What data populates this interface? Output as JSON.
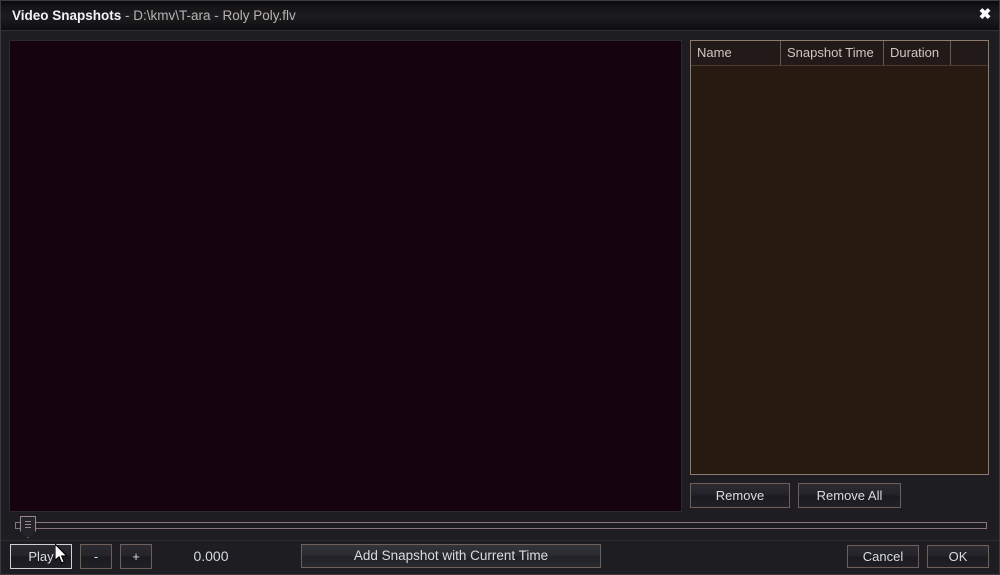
{
  "window": {
    "title_main": "Video Snapshots",
    "title_sub": " - D:\\kmv\\T-ara - Roly Poly.flv",
    "close_label": "✖",
    "bg_color": "#1e1e22"
  },
  "video_preview": {
    "bg_color": "#14020f"
  },
  "snapshot_list": {
    "columns": [
      {
        "label": "Name"
      },
      {
        "label": "Snapshot Time"
      },
      {
        "label": "Duration"
      },
      {
        "label": ""
      }
    ],
    "rows": [],
    "bg_color": "#271a10",
    "border_color": "#8d7b70"
  },
  "list_actions": {
    "remove_label": "Remove",
    "remove_all_label": "Remove All"
  },
  "timeline": {
    "position": 0,
    "min": 0,
    "max": 100
  },
  "transport": {
    "play_label": "Play",
    "minus_label": "-",
    "plus_label": "+",
    "time_value": "0.000",
    "add_snapshot_label": "Add Snapshot with Current Time"
  },
  "dialog_actions": {
    "cancel_label": "Cancel",
    "ok_label": "OK"
  }
}
